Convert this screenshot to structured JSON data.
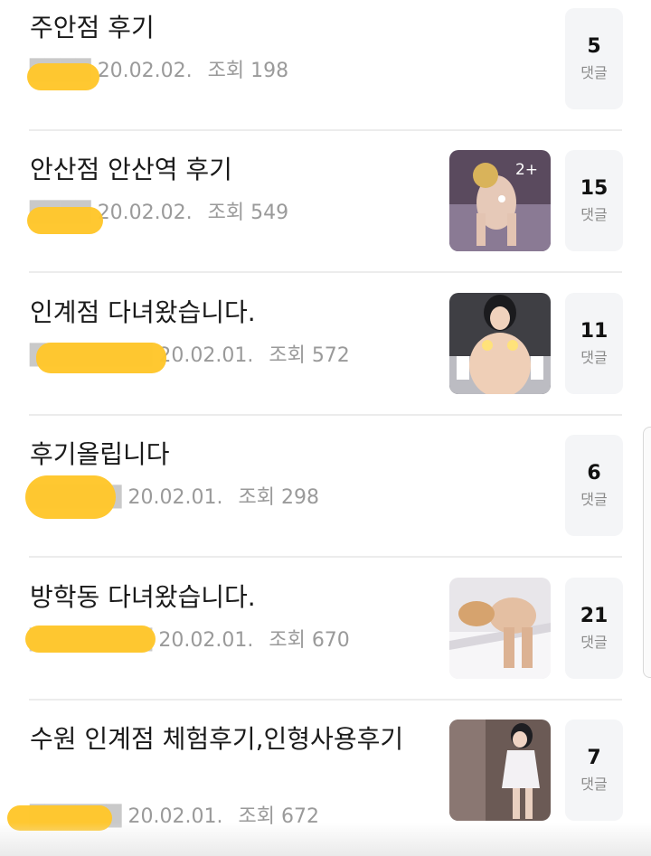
{
  "posts": [
    {
      "title": "주안점 후기",
      "date": "20.02.02.",
      "views_label": "조회",
      "views": "198",
      "comments": "5",
      "comments_label": "댓글",
      "has_image": false
    },
    {
      "title": "안산점 안산역 후기",
      "date": "20.02.02.",
      "views_label": "조회",
      "views": "549",
      "comments": "15",
      "comments_label": "댓글",
      "has_image": true,
      "image_badge": "2+"
    },
    {
      "title": "인계점 다녀왔습니다.",
      "date": "20.02.01.",
      "views_label": "조회",
      "views": "572",
      "comments": "11",
      "comments_label": "댓글",
      "has_image": true
    },
    {
      "title": "후기올립니다",
      "date": "20.02.01.",
      "views_label": "조회",
      "views": "298",
      "comments": "6",
      "comments_label": "댓글",
      "has_image": false
    },
    {
      "title": "방학동 다녀왔습니다.",
      "date": "20.02.01.",
      "views_label": "조회",
      "views": "670",
      "comments": "21",
      "comments_label": "댓글",
      "has_image": true
    },
    {
      "title": "수원 인계점 체험후기,인형사용후기",
      "date": "20.02.01.",
      "views_label": "조회",
      "views": "672",
      "comments": "7",
      "comments_label": "댓글",
      "has_image": true
    }
  ],
  "colors": {
    "redaction": "#ffc62a",
    "comment_box": "#f4f5f7",
    "meta_text": "#9a9a9a"
  }
}
